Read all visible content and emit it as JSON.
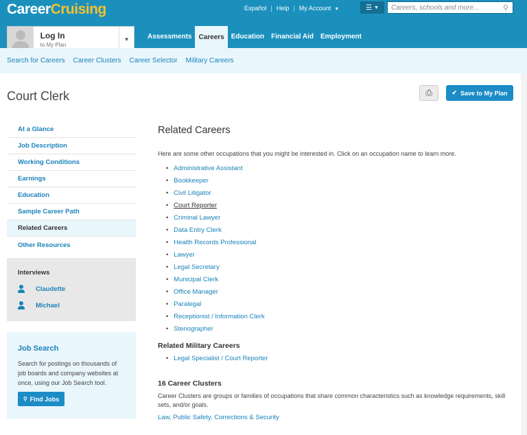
{
  "header": {
    "logo_part1": "Career",
    "logo_part2": "Cruising",
    "links": {
      "espanol": "Español",
      "help": "Help",
      "account": "My Account"
    },
    "search_placeholder": "Careers, schools and more..."
  },
  "login": {
    "title": "Log In",
    "subtitle": "to My Plan"
  },
  "nav": {
    "tabs": [
      "Assessments",
      "Careers",
      "Education",
      "Financial Aid",
      "Employment"
    ],
    "active": "Careers"
  },
  "subnav": [
    "Search for Careers",
    "Career Clusters",
    "Career Selector",
    "Military Careers"
  ],
  "page": {
    "title": "Court Clerk",
    "save_label": "Save to My Plan"
  },
  "sidebar": {
    "items": [
      "At a Glance",
      "Job Description",
      "Working Conditions",
      "Earnings",
      "Education",
      "Sample Career Path",
      "Related Careers",
      "Other Resources"
    ],
    "active": "Related Careers"
  },
  "interviews": {
    "title": "Interviews",
    "people": [
      "Claudette",
      "Michael"
    ]
  },
  "jobsearch": {
    "title": "Job Search",
    "text": "Search for postings on thousands of job boards and company websites at once, using our Job Search tool.",
    "button": "Find Jobs"
  },
  "main": {
    "heading": "Related Careers",
    "intro": "Here are some other occupations that you might be interested in. Click on an occupation name to learn more.",
    "careers": [
      "Administrative Assistant",
      "Bookkeeper",
      "Civil Litigator",
      "Court Reporter",
      "Criminal Lawyer",
      "Data Entry Clerk",
      "Health Records Professional",
      "Lawyer",
      "Legal Secretary",
      "Municipal Clerk",
      "Office Manager",
      "Paralegal",
      "Receptionist / Information Clerk",
      "Stenographer"
    ],
    "hovered_career": "Court Reporter",
    "military_heading": "Related Military Careers",
    "military": [
      "Legal Specialist / Court Reporter"
    ],
    "clusters_heading": "16 Career Clusters",
    "clusters_text": "Career Clusters are groups or families of occupations that share common characteristics such as knowledge requirements, skill sets, and/or goals.",
    "cluster_link": "Law, Public Safety, Corrections & Security"
  }
}
